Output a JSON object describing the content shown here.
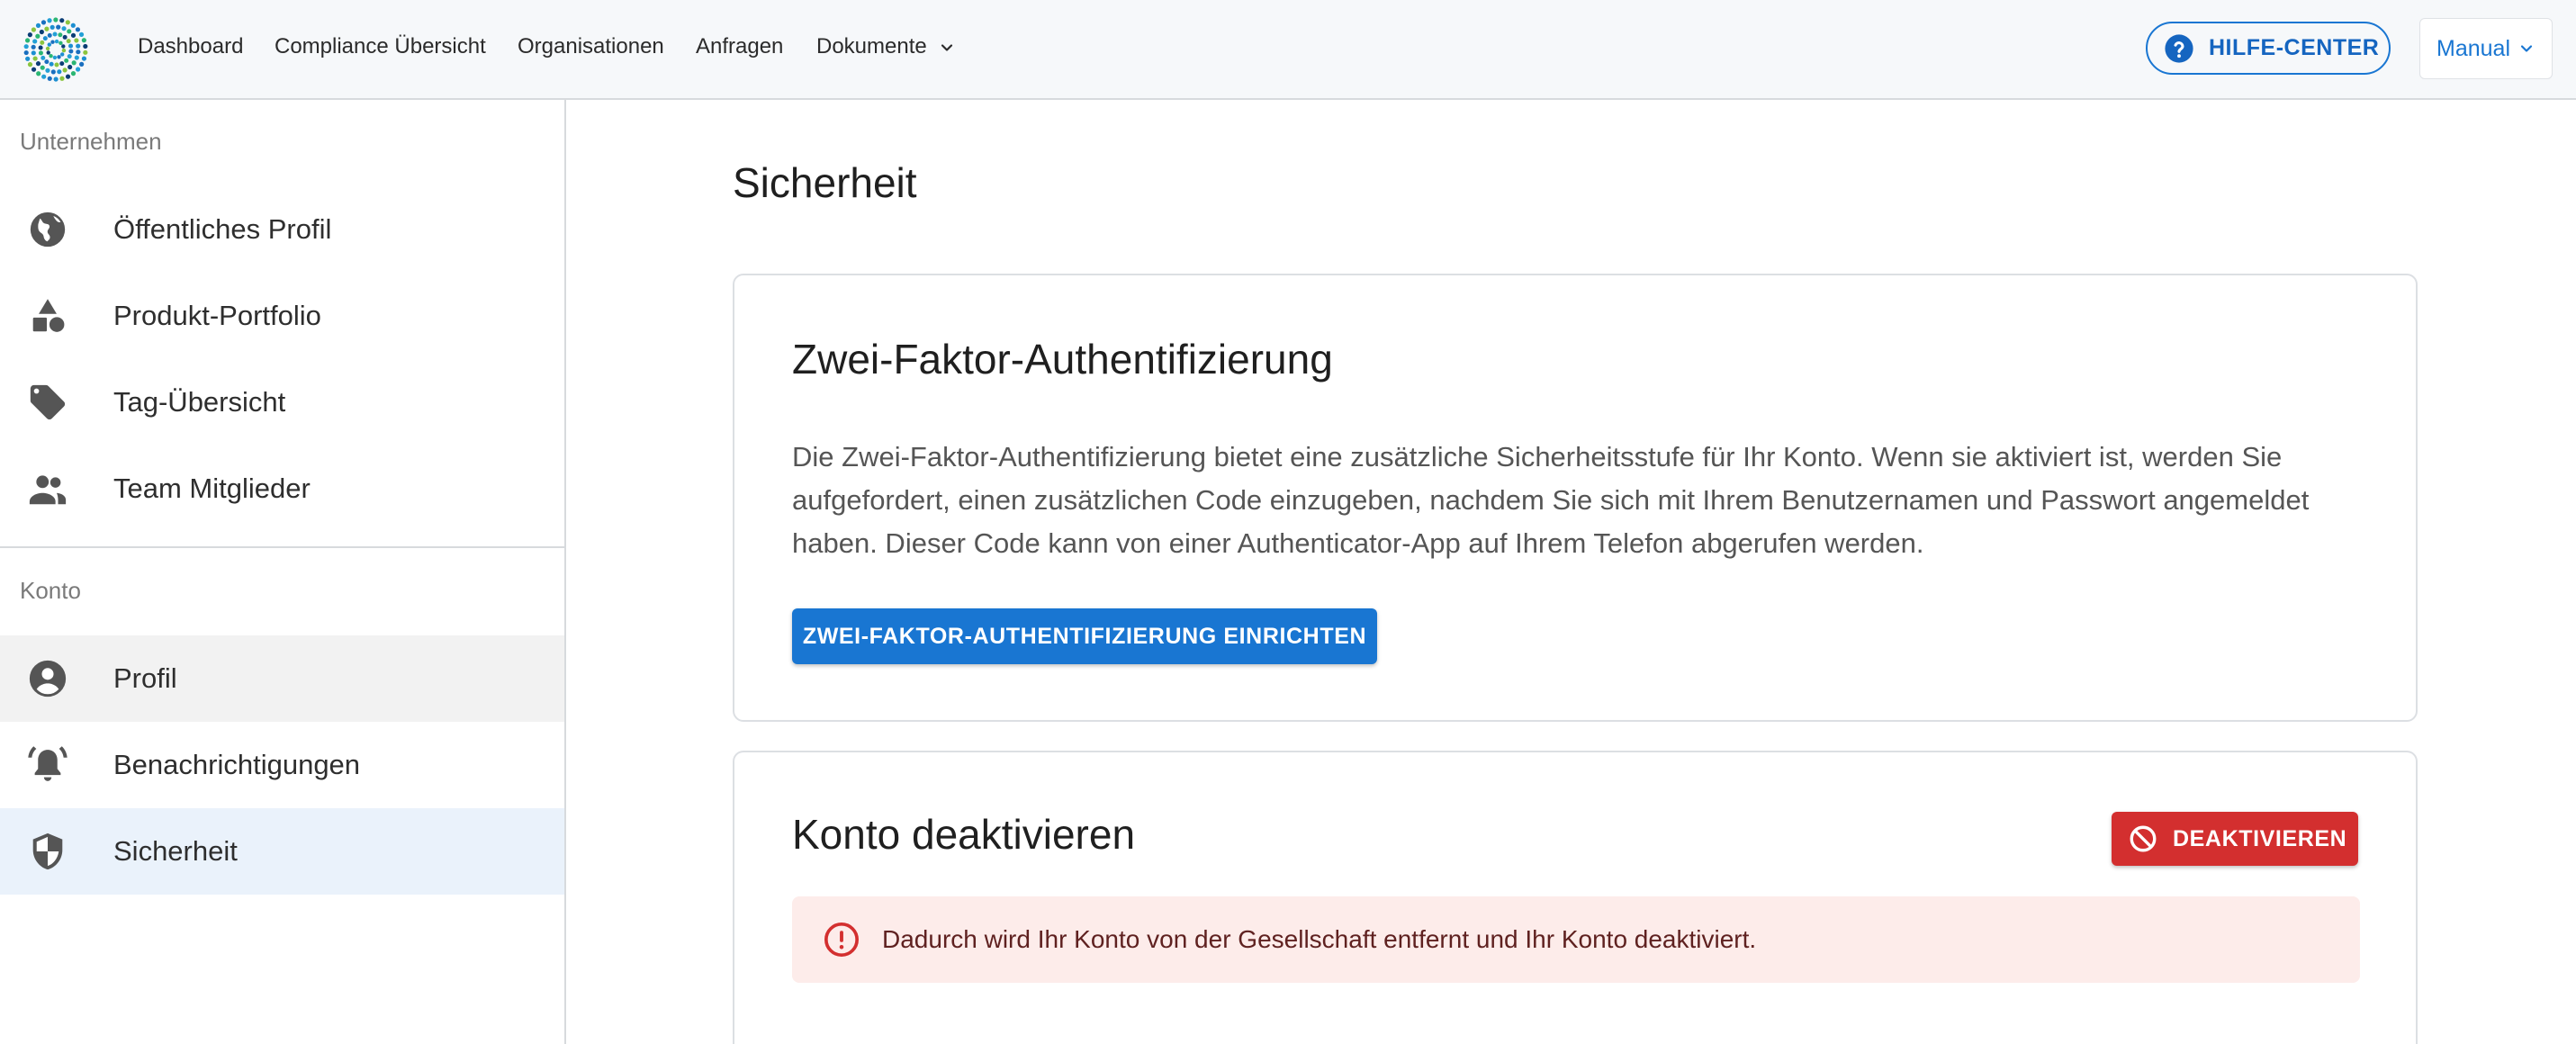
{
  "topbar": {
    "logo": "company-logo-dots",
    "nav": [
      {
        "label": "Dashboard"
      },
      {
        "label": "Compliance Übersicht"
      },
      {
        "label": "Organisationen"
      },
      {
        "label": "Anfragen"
      },
      {
        "label": "Dokumente",
        "has_dropdown": true
      }
    ],
    "help_button": {
      "label": "HILFE-CENTER",
      "icon": "help-circle-icon"
    },
    "manual_select": {
      "label": "Manual",
      "icon": "chevron-down-icon"
    }
  },
  "sidebar": {
    "sections": [
      {
        "title": "Unternehmen",
        "items": [
          {
            "label": "Öffentliches Profil",
            "icon": "globe-icon"
          },
          {
            "label": "Produkt-Portfolio",
            "icon": "shapes-icon"
          },
          {
            "label": "Tag-Übersicht",
            "icon": "tag-icon"
          },
          {
            "label": "Team Mitglieder",
            "icon": "people-icon"
          }
        ]
      },
      {
        "title": "Konto",
        "items": [
          {
            "label": "Profil",
            "icon": "account-circle-icon"
          },
          {
            "label": "Benachrichtigungen",
            "icon": "alarm-bell-icon"
          },
          {
            "label": "Sicherheit",
            "icon": "shield-icon",
            "active": true
          }
        ]
      }
    ]
  },
  "main": {
    "title": "Sicherheit",
    "two_factor": {
      "title": "Zwei-Faktor-Authentifizierung",
      "description": "Die Zwei-Faktor-Authentifizierung bietet eine zusätzliche Sicherheitsstufe für Ihr Konto. Wenn sie aktiviert ist, werden Sie aufgefordert, einen zusätzlichen Code einzugeben, nachdem Sie sich mit Ihrem Benutzernamen und Passwort angemeldet haben. Dieser Code kann von einer Authenticator-App auf Ihrem Telefon abgerufen werden.",
      "button_label": "ZWEI-FAKTOR-AUTHENTIFIZIERUNG EINRICHTEN"
    },
    "deactivate": {
      "title": "Konto deaktivieren",
      "button_label": "DEAKTIVIEREN",
      "button_icon": "block-icon",
      "alert_text": "Dadurch wird Ihr Konto von der Gesellschaft entfernt und Ihr Konto deaktiviert.",
      "alert_icon": "error-outline-icon"
    }
  },
  "colors": {
    "primary": "#1976d2",
    "danger": "#d32f2f",
    "alert_bg": "#fdecea",
    "active_bg": "#eaf2fb"
  }
}
